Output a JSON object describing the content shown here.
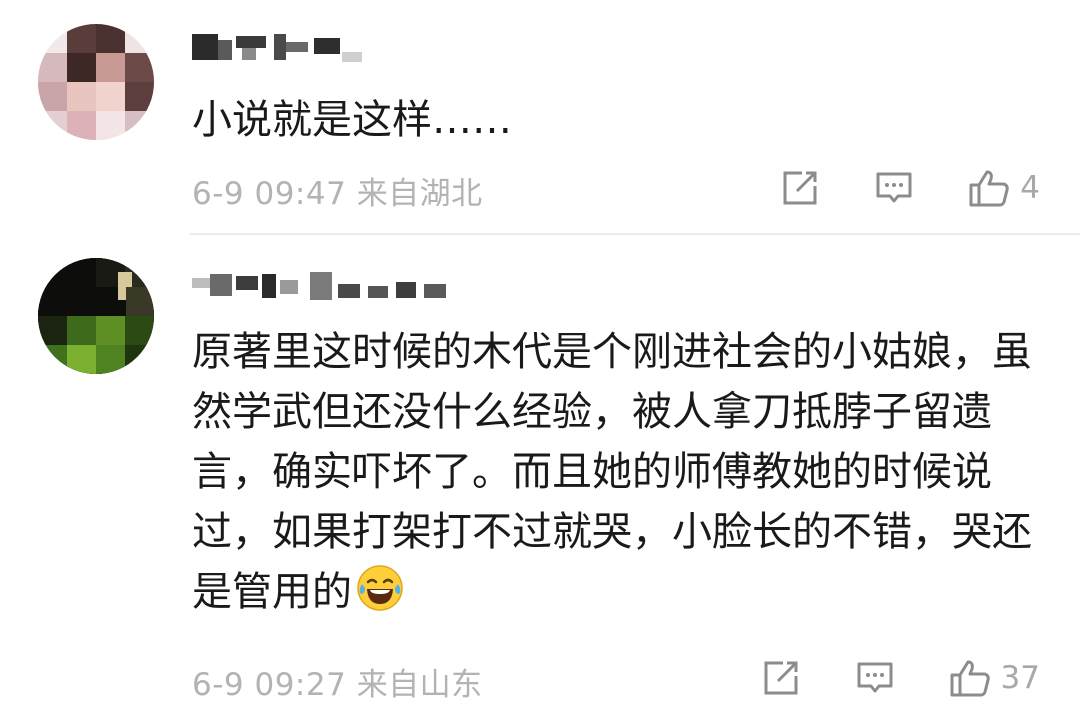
{
  "comments": [
    {
      "content": "小说就是这样……",
      "time": "6-9 09:47",
      "location": "来自湖北",
      "likes": "4"
    },
    {
      "content": "原著里这时候的木代是个刚进社会的小姑娘，虽然学武但还没什么经验，被人拿刀抵脖子留遗言，确实吓坏了。而且她的师傅教她的时候说过，如果打架打不过就哭，小脸长的不错，哭还是管用的",
      "emoji": "laughing-tears-emoji",
      "time": "6-9 09:27",
      "location": "来自山东",
      "likes": "37"
    }
  ],
  "icons": [
    "share-icon",
    "reply-icon",
    "like-icon"
  ]
}
